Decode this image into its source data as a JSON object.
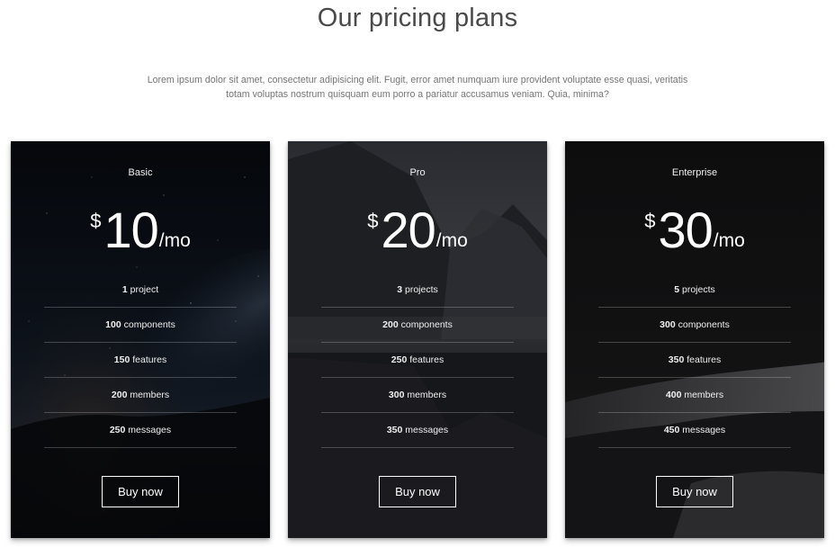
{
  "header": {
    "title": "Our pricing plans",
    "subtitle": "Lorem ipsum dolor sit amet, consectetur adipisicing elit. Fugit, error amet numquam iure provident voluptate esse quasi, veritatis totam voluptas nostrum quisquam eum porro a pariatur accusamus veniam. Quia, minima?"
  },
  "plans": [
    {
      "name": "Basic",
      "currency": "$",
      "price": "10",
      "period": "/mo",
      "features": [
        {
          "value": "1",
          "label": "project"
        },
        {
          "value": "100",
          "label": "components"
        },
        {
          "value": "150",
          "label": "features"
        },
        {
          "value": "200",
          "label": "members"
        },
        {
          "value": "250",
          "label": "messages"
        }
      ],
      "button": "Buy now"
    },
    {
      "name": "Pro",
      "currency": "$",
      "price": "20",
      "period": "/mo",
      "features": [
        {
          "value": "3",
          "label": "projects"
        },
        {
          "value": "200",
          "label": "components"
        },
        {
          "value": "250",
          "label": "features"
        },
        {
          "value": "300",
          "label": "members"
        },
        {
          "value": "350",
          "label": "messages"
        }
      ],
      "button": "Buy now"
    },
    {
      "name": "Enterprise",
      "currency": "$",
      "price": "30",
      "period": "/mo",
      "features": [
        {
          "value": "5",
          "label": "projects"
        },
        {
          "value": "300",
          "label": "components"
        },
        {
          "value": "350",
          "label": "features"
        },
        {
          "value": "400",
          "label": "members"
        },
        {
          "value": "450",
          "label": "messages"
        }
      ],
      "button": "Buy now"
    }
  ],
  "colors": {
    "title": "#4a4a4a",
    "subtitle": "#757575",
    "card_text": "#ffffff"
  }
}
